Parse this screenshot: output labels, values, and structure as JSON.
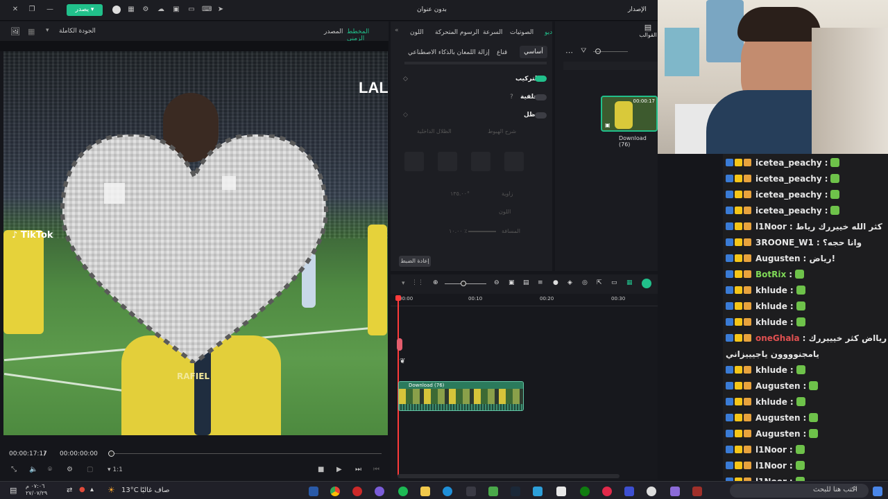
{
  "topbar": {
    "export_label": "يصدر",
    "title": "بدون عنوان",
    "version_label": "الإصدار"
  },
  "player": {
    "quality": "الجودة الكاملة",
    "tab_timeline": "المخطط الزمني",
    "tab_source": "المصدر",
    "current_time": "00:00:17:17",
    "separator": "/",
    "total_time": "00:00:00:00",
    "ratio": "1:1",
    "overlay_text": "LAL",
    "tiktok_label": "TikTok",
    "jersey_text": "RAFIEL"
  },
  "props": {
    "tabs": [
      "اللون",
      "الرسوم المتحركة",
      "السرعة",
      "الصوتيات",
      "ديو"
    ],
    "subtabs": [
      "أساسي",
      "قناع",
      "إزالة اللمعان بالذكاء الاصطناعي"
    ],
    "rows": [
      "التركيب",
      "خلفية",
      "ظل"
    ],
    "faded_rows": [
      "شرح الهبوط",
      "الظلال الداخلية",
      "زاوية",
      "اللون",
      "المسافة",
      "التعتيم"
    ],
    "angle_value": "١٣٥.٠٠°",
    "dist_value": "١٠.٠٠ ٪",
    "reset_label": "إعادة الضبط"
  },
  "assets": {
    "templates_label": "القوالب",
    "clip_name": "Download (76)",
    "clip_duration": "00:00:17"
  },
  "timeline": {
    "ruler": [
      "00:00",
      "00:10",
      "00:20",
      "00:30",
      "00:40"
    ],
    "clip_label": "Download (76)"
  },
  "chat": {
    "messages": [
      {
        "user": "icetea_peachy",
        "text": ":",
        "color": "#e6e6e6"
      },
      {
        "user": "icetea_peachy",
        "text": ":",
        "color": "#e6e6e6"
      },
      {
        "user": "icetea_peachy",
        "text": ":",
        "color": "#e6e6e6"
      },
      {
        "user": "icetea_peachy",
        "text": ":",
        "color": "#e6e6e6"
      },
      {
        "user": "l1Noor",
        "text": ": كثر الله خييررك رياط",
        "color": "#e6e6e6"
      },
      {
        "user": "3ROONE_W1",
        "text": ": وانا حجه؟",
        "color": "#e6e6e6"
      },
      {
        "user": "Augusten",
        "text": ": رياض!",
        "color": "#e6e6e6"
      },
      {
        "user": "BotRix",
        "text": ":",
        "color": "#7fd957"
      },
      {
        "user": "khlude",
        "text": ":",
        "color": "#e6e6e6"
      },
      {
        "user": "khlude",
        "text": ":",
        "color": "#e6e6e6"
      },
      {
        "user": "khlude",
        "text": ":",
        "color": "#e6e6e6"
      },
      {
        "user": "oneGhala",
        "text": ": ريااض كثر خيييررك",
        "color": "#e05050"
      },
      {
        "user": "",
        "text": "يامجنوووون ياجيييزاني",
        "color": "#e6e6e6"
      },
      {
        "user": "khlude",
        "text": ":",
        "color": "#e6e6e6"
      },
      {
        "user": "Augusten",
        "text": ":",
        "color": "#e6e6e6"
      },
      {
        "user": "khlude",
        "text": ":",
        "color": "#e6e6e6"
      },
      {
        "user": "Augusten",
        "text": ":",
        "color": "#e6e6e6"
      },
      {
        "user": "Augusten",
        "text": ":",
        "color": "#e6e6e6"
      },
      {
        "user": "l1Noor",
        "text": ":",
        "color": "#e6e6e6"
      },
      {
        "user": "l1Noor",
        "text": ":",
        "color": "#e6e6e6"
      },
      {
        "user": "l1Noor",
        "text": ":",
        "color": "#e6e6e6"
      }
    ],
    "search_placeholder": "اكتب هنا للبحث"
  },
  "taskbar": {
    "weather": "13°C",
    "weather_text": "صاف غالبًا",
    "time": "٠٧:٠٦ م",
    "date": "٢٧/٠٧/٢٩"
  },
  "colors": {
    "accent": "#21c08b",
    "playhead": "#ff3b3b"
  }
}
